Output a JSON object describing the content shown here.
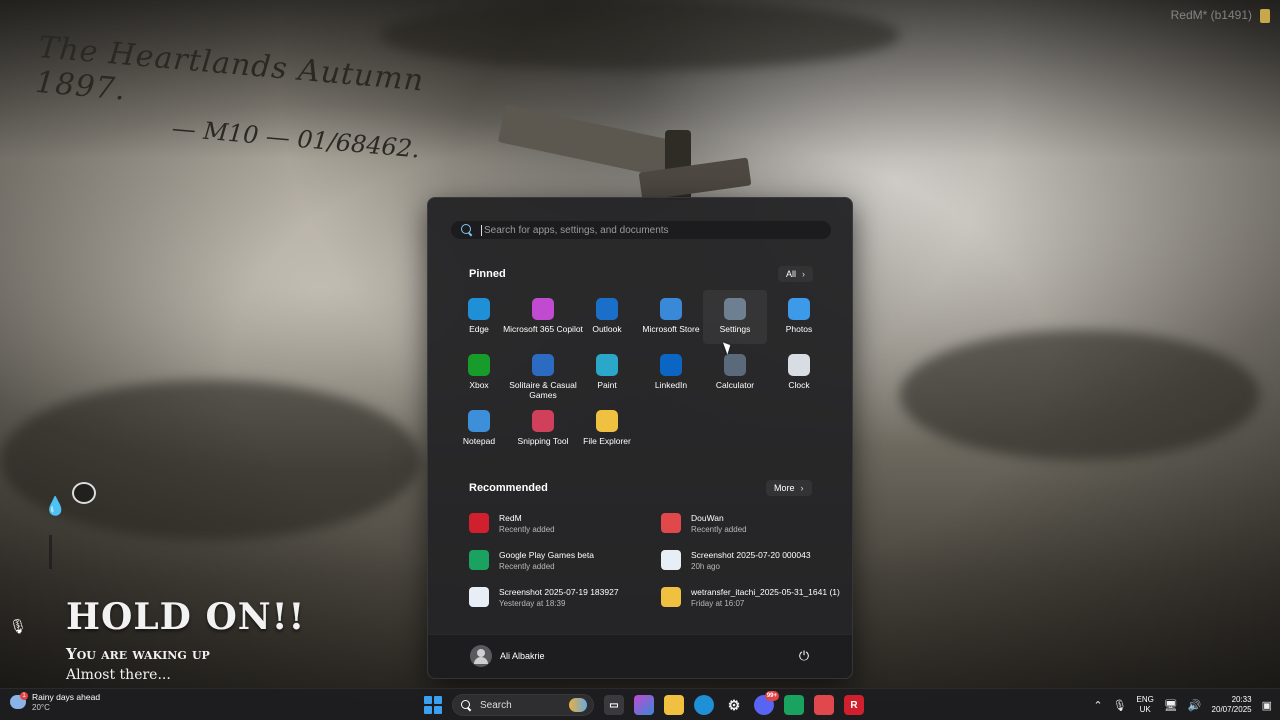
{
  "desktop": {
    "handwriting_line1": "The Heartlands Autumn 1897.",
    "handwriting_line2": "— M10 — 01/68462.",
    "version_text": "RedM* (b1491)",
    "loading_title": "HOLD ON!!",
    "loading_subtitle": "You are waking up",
    "loading_status": "Almost there..."
  },
  "start_menu": {
    "search_placeholder": "Search for apps, settings, and documents",
    "pinned_title": "Pinned",
    "all_button": "All",
    "pinned_apps": [
      {
        "label": "Edge",
        "icon": "edge-icon",
        "color": "#1f8fd6"
      },
      {
        "label": "Microsoft 365 Copilot",
        "icon": "m365-icon",
        "color": "#c04ad0"
      },
      {
        "label": "Outlook",
        "icon": "outlook-icon",
        "color": "#1a6fc8"
      },
      {
        "label": "Microsoft Store",
        "icon": "store-icon",
        "color": "#3a88d8"
      },
      {
        "label": "Settings",
        "icon": "gear-icon",
        "color": "#6f7f92"
      },
      {
        "label": "Photos",
        "icon": "photos-icon",
        "color": "#3d9ae8"
      },
      {
        "label": "Xbox",
        "icon": "xbox-icon",
        "color": "#179c2b"
      },
      {
        "label": "Solitaire & Casual Games",
        "icon": "solitaire-icon",
        "color": "#2b6cc2"
      },
      {
        "label": "Paint",
        "icon": "paint-icon",
        "color": "#2aa7c9"
      },
      {
        "label": "LinkedIn",
        "icon": "linkedin-icon",
        "color": "#0a66c2"
      },
      {
        "label": "Calculator",
        "icon": "calculator-icon",
        "color": "#5b6a7b"
      },
      {
        "label": "Clock",
        "icon": "clock-icon",
        "color": "#d8dde3"
      },
      {
        "label": "Notepad",
        "icon": "notepad-icon",
        "color": "#3c8fd8"
      },
      {
        "label": "Snipping Tool",
        "icon": "snipping-icon",
        "color": "#d0405a"
      },
      {
        "label": "File Explorer",
        "icon": "folder-icon",
        "color": "#f0c040"
      }
    ],
    "recommended_title": "Recommended",
    "more_button": "More",
    "recommended": [
      {
        "name": "RedM",
        "sub": "Recently added",
        "icon": "redm-icon",
        "color": "#d0202e"
      },
      {
        "name": "DouWan",
        "sub": "Recently added",
        "icon": "douwan-icon",
        "color": "#e0484c"
      },
      {
        "name": "Google Play Games beta",
        "sub": "Recently added",
        "icon": "play-games-icon",
        "color": "#1aa260"
      },
      {
        "name": "Screenshot 2025-07-20 000043",
        "sub": "20h ago",
        "icon": "image-file-icon",
        "color": "#e8eef6"
      },
      {
        "name": "Screenshot 2025-07-19 183927",
        "sub": "Yesterday at 18:39",
        "icon": "image-file-icon",
        "color": "#e8eef6"
      },
      {
        "name": "wetransfer_itachi_2025-05-31_1641 (1)",
        "sub": "Friday at 16:07",
        "icon": "folder-icon",
        "color": "#f0c040"
      }
    ],
    "user_name": "Ali Albakrie"
  },
  "taskbar": {
    "weather_title": "Rainy days ahead",
    "weather_temp": "20°C",
    "weather_badge": "1",
    "search_label": "Search",
    "lang_top": "ENG",
    "lang_bottom": "UK",
    "time": "20:33",
    "date": "20/07/2025",
    "discord_badge": "99+"
  }
}
